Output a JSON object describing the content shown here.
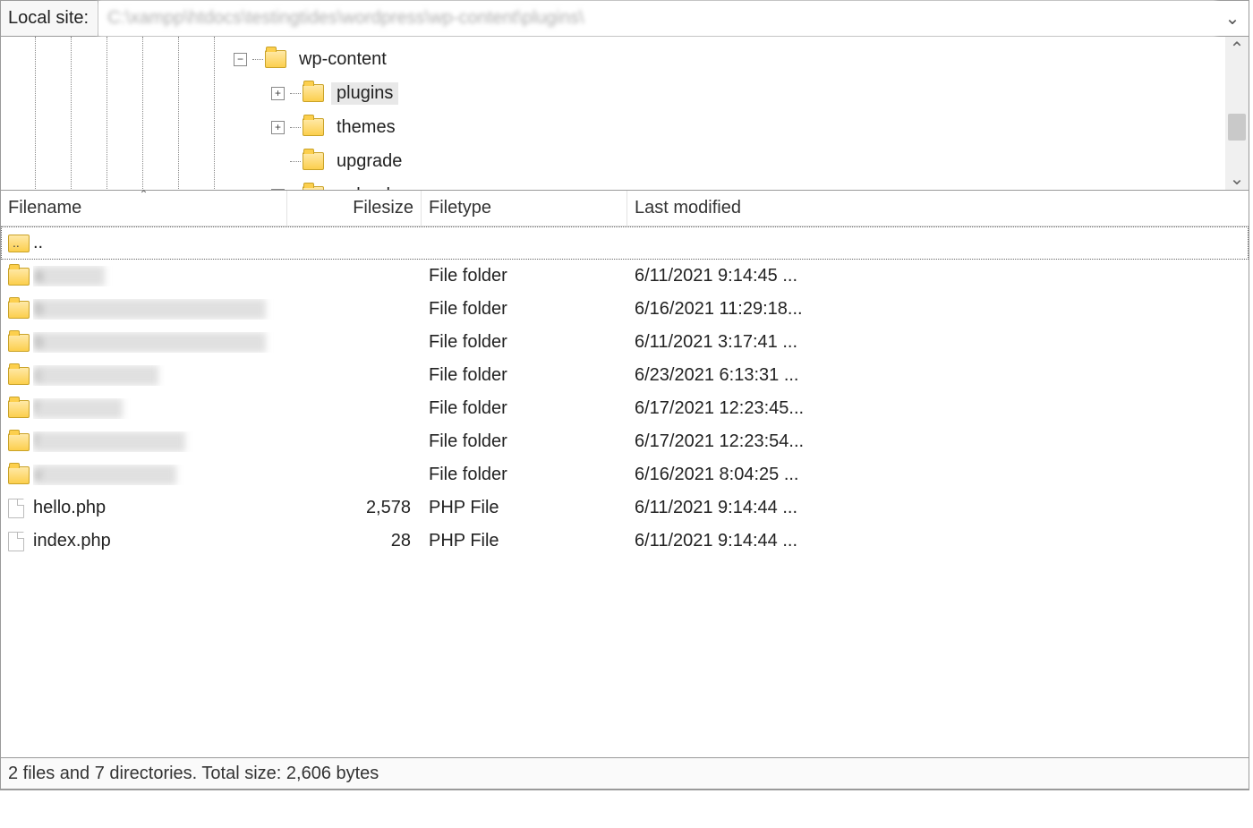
{
  "pathbar": {
    "label": "Local site:",
    "path_value": "C:\\xampp\\htdocs\\testingtides\\wordpress\\wp-content\\plugins\\"
  },
  "tree": {
    "rows": [
      {
        "indent": 260,
        "expander": "−",
        "name": "wp-content",
        "selected": false
      },
      {
        "indent": 302,
        "expander": "+",
        "name": "plugins",
        "selected": true
      },
      {
        "indent": 302,
        "expander": "+",
        "name": "themes",
        "selected": false
      },
      {
        "indent": 302,
        "expander": "",
        "name": "upgrade",
        "selected": false
      },
      {
        "indent": 302,
        "expander": "+",
        "name": "uploads",
        "selected": false
      }
    ]
  },
  "columns": {
    "filename": "Filename",
    "filesize": "Filesize",
    "filetype": "Filetype",
    "modified": "Last modified"
  },
  "files": [
    {
      "kind": "parent",
      "name": "..",
      "size": "",
      "type": "",
      "modified": "",
      "blurred": false,
      "focused": true
    },
    {
      "kind": "folder",
      "name": "a",
      "size": "",
      "type": "File folder",
      "modified": "6/11/2021 9:14:45 ...",
      "blurred": true,
      "focused": false
    },
    {
      "kind": "folder",
      "name": "b",
      "size": "",
      "type": "File folder",
      "modified": "6/16/2021 11:29:18...",
      "blurred": true,
      "focused": false
    },
    {
      "kind": "folder",
      "name": "b",
      "size": "",
      "type": "File folder",
      "modified": "6/11/2021 3:17:41 ...",
      "blurred": true,
      "focused": false
    },
    {
      "kind": "folder",
      "name": "c",
      "size": "",
      "type": "File folder",
      "modified": "6/23/2021 6:13:31 ...",
      "blurred": true,
      "focused": false
    },
    {
      "kind": "folder",
      "name": "f",
      "size": "",
      "type": "File folder",
      "modified": "6/17/2021 12:23:45...",
      "blurred": true,
      "focused": false
    },
    {
      "kind": "folder",
      "name": "f",
      "size": "",
      "type": "File folder",
      "modified": "6/17/2021 12:23:54...",
      "blurred": true,
      "focused": false
    },
    {
      "kind": "folder",
      "name": "v",
      "size": "",
      "type": "File folder",
      "modified": "6/16/2021 8:04:25 ...",
      "blurred": true,
      "focused": false
    },
    {
      "kind": "file",
      "name": "hello.php",
      "size": "2,578",
      "type": "PHP File",
      "modified": "6/11/2021 9:14:44 ...",
      "blurred": false,
      "focused": false
    },
    {
      "kind": "file",
      "name": "index.php",
      "size": "28",
      "type": "PHP File",
      "modified": "6/11/2021 9:14:44 ...",
      "blurred": false,
      "focused": false
    }
  ],
  "status": "2 files and 7 directories. Total size: 2,606 bytes"
}
